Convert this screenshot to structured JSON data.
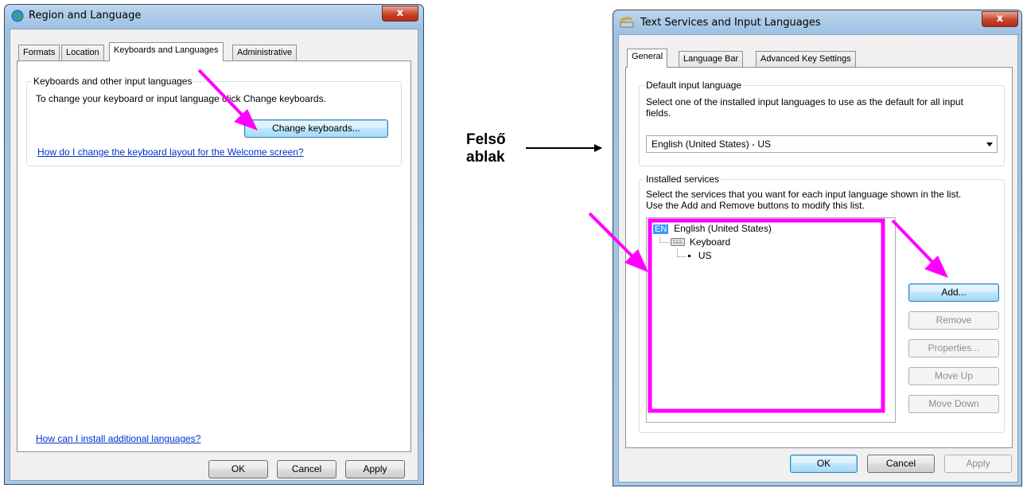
{
  "left_window": {
    "title": "Region and Language",
    "close_label": "x",
    "tabs": [
      {
        "label": "Formats"
      },
      {
        "label": "Location"
      },
      {
        "label": "Keyboards and Languages"
      },
      {
        "label": "Administrative"
      }
    ],
    "active_tab": "Keyboards and Languages",
    "group_title": "Keyboards and other input languages",
    "instruction": "To change your keyboard or input language click Change keyboards.",
    "change_keyboards_label": "Change keyboards...",
    "welcome_link": "How do I change the keyboard layout for the Welcome screen?",
    "install_link": "How can I install additional languages?",
    "buttons": {
      "ok": "OK",
      "cancel": "Cancel",
      "apply": "Apply"
    }
  },
  "right_window": {
    "title": "Text Services and Input Languages",
    "close_label": "x",
    "tabs": [
      {
        "label": "General"
      },
      {
        "label": "Language Bar"
      },
      {
        "label": "Advanced Key Settings"
      }
    ],
    "active_tab": "General",
    "default_group": {
      "title": "Default input language",
      "description_line1": "Select one of the installed input languages to use as the default for all input",
      "description_line2": "fields.",
      "selected_value": "English (United States) - US"
    },
    "services_group": {
      "title": "Installed services",
      "description_line1": "Select the services that you want for each input language shown in the list.",
      "description_line2": "Use the Add and Remove buttons to modify this list.",
      "tree": {
        "language_badge": "EN",
        "language": "English (United States)",
        "category": "Keyboard",
        "layout": "US"
      },
      "buttons": {
        "add": "Add...",
        "remove": "Remove",
        "properties": "Properties...",
        "move_up": "Move Up",
        "move_down": "Move Down"
      }
    },
    "buttons": {
      "ok": "OK",
      "cancel": "Cancel",
      "apply": "Apply"
    }
  },
  "annotation": {
    "label_line1": "Felső",
    "label_line2": "ablak",
    "highlight_color": "#ff00ff"
  }
}
